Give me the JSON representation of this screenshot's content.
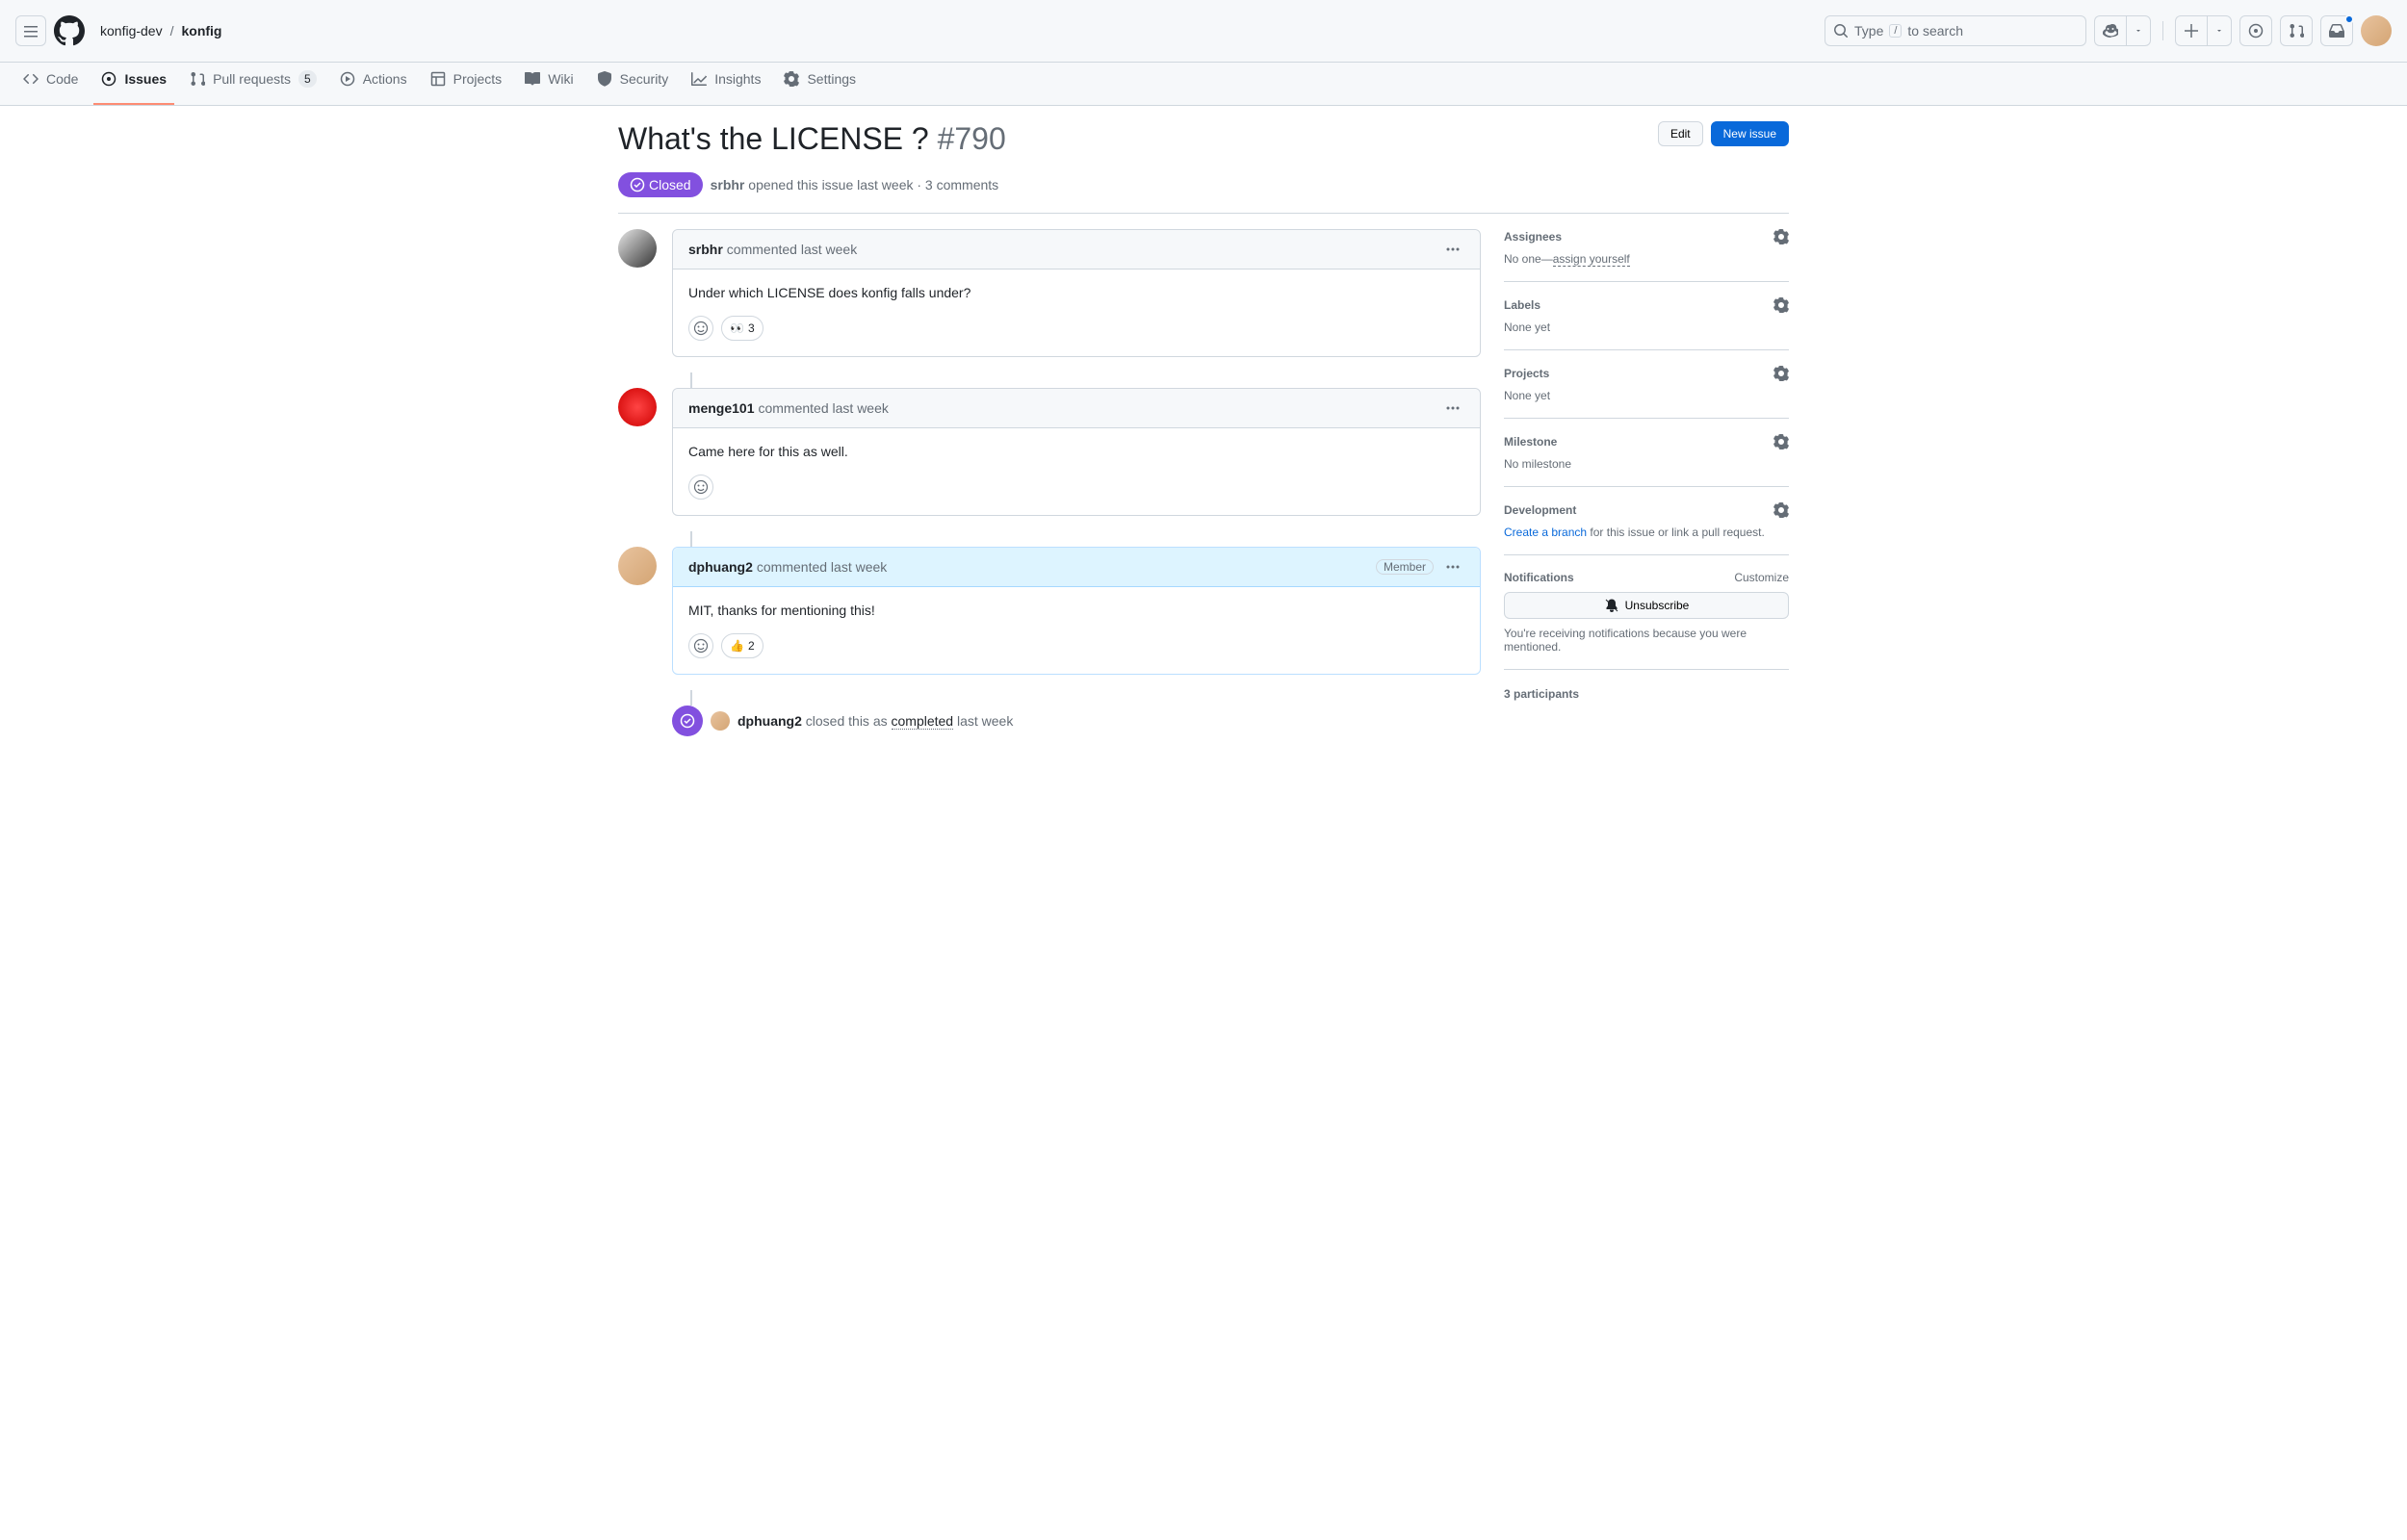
{
  "header": {
    "breadcrumb": {
      "owner": "konfig-dev",
      "sep": "/",
      "repo": "konfig"
    },
    "search": {
      "prefix": "Type",
      "slash": "/",
      "suffix": "to search"
    }
  },
  "nav": {
    "code": "Code",
    "issues": "Issues",
    "pulls": "Pull requests",
    "pulls_count": "5",
    "actions": "Actions",
    "projects": "Projects",
    "wiki": "Wiki",
    "security": "Security",
    "insights": "Insights",
    "settings": "Settings"
  },
  "issue": {
    "title": "What's the LICENSE ?",
    "number": "#790",
    "edit": "Edit",
    "new_issue": "New issue",
    "state": "Closed",
    "meta_author": "srbhr",
    "meta_text": " opened this issue last week · 3 comments"
  },
  "comments": [
    {
      "author": "srbhr",
      "meta": " commented last week",
      "body": "Under which LICENSE does konfig falls under?",
      "reactions": [
        {
          "emoji": "👀",
          "count": "3"
        }
      ],
      "member": false
    },
    {
      "author": "menge101",
      "meta": " commented last week",
      "body": "Came here for this as well.",
      "reactions": [],
      "member": false
    },
    {
      "author": "dphuang2",
      "meta": " commented last week",
      "body": "MIT, thanks for mentioning this!",
      "reactions": [
        {
          "emoji": "👍",
          "count": "2"
        }
      ],
      "member": true,
      "member_label": "Member"
    }
  ],
  "event": {
    "author": "dphuang2",
    "text1": " closed this as ",
    "completed": "completed",
    "text2": " last week"
  },
  "sidebar": {
    "assignees": {
      "title": "Assignees",
      "none_prefix": "No one—",
      "assign": "assign yourself"
    },
    "labels": {
      "title": "Labels",
      "none": "None yet"
    },
    "projects": {
      "title": "Projects",
      "none": "None yet"
    },
    "milestone": {
      "title": "Milestone",
      "none": "No milestone"
    },
    "development": {
      "title": "Development",
      "create": "Create a branch",
      "rest": " for this issue or link a pull request."
    },
    "notifications": {
      "title": "Notifications",
      "customize": "Customize",
      "unsubscribe": "Unsubscribe",
      "desc": "You're receiving notifications because you were mentioned."
    },
    "participants": {
      "title": "3 participants"
    }
  }
}
